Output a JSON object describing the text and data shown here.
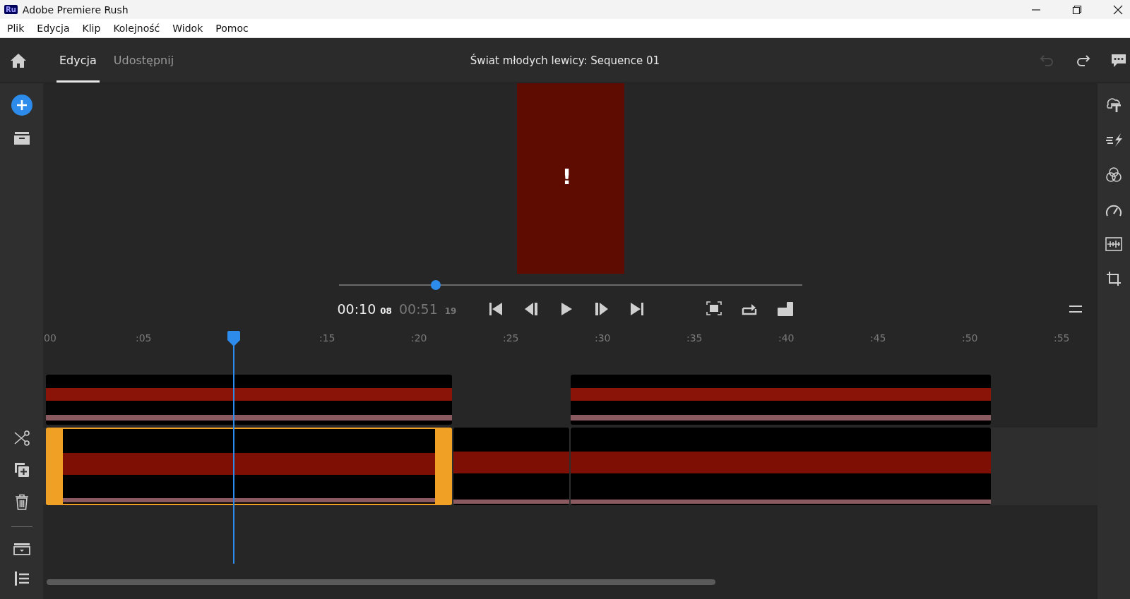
{
  "window": {
    "title": "Adobe Premiere Rush",
    "badge": "Ru"
  },
  "menu": [
    "Plik",
    "Edycja",
    "Klip",
    "Kolejność",
    "Widok",
    "Pomoc"
  ],
  "header": {
    "tabs": [
      {
        "label": "Edycja",
        "selected": true
      },
      {
        "label": "Udostępnij",
        "selected": false
      }
    ],
    "title": "Świat młodych lewicy: Sequence 01",
    "undo": {
      "disabled": true
    },
    "redo": {
      "disabled": false
    }
  },
  "preview": {
    "alert": "!"
  },
  "transport": {
    "level": 0.21,
    "current": "00:10",
    "current_frames": "08",
    "total": "00:51",
    "total_frames": "19"
  },
  "ruler": [
    "00",
    ":05",
    ":15",
    ":20",
    ":25",
    ":30",
    ":35",
    ":40",
    ":45",
    ":50",
    ":55"
  ],
  "tracks": [
    {
      "kind": "overlay",
      "clips": [
        {
          "selected": false
        },
        {
          "selected": false
        }
      ]
    },
    {
      "kind": "main",
      "clips": [
        {
          "selected": true
        },
        {
          "selected": false
        },
        {
          "selected": false
        }
      ]
    }
  ]
}
